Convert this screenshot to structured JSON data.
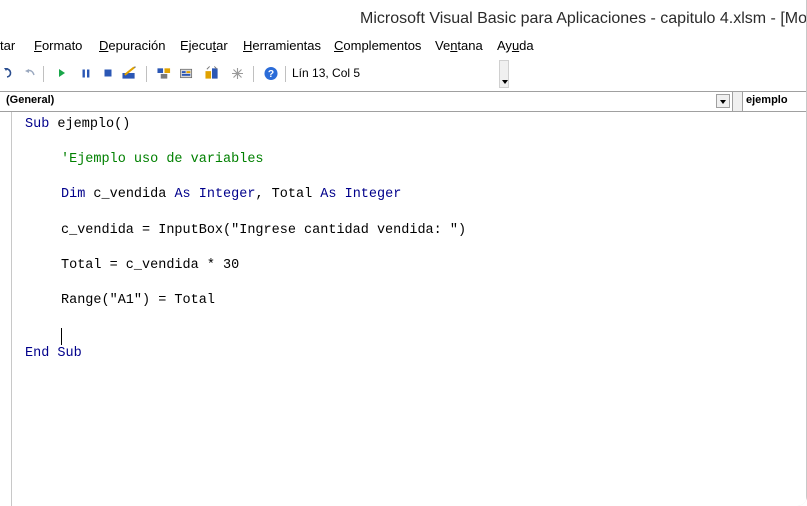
{
  "window": {
    "title": "Microsoft Visual Basic para Aplicaciones - capitulo 4.xlsm - [Mo"
  },
  "menu": {
    "items": [
      {
        "pre": "tar",
        "u": "",
        "post": ""
      },
      {
        "pre": "",
        "u": "F",
        "post": "ormato"
      },
      {
        "pre": "",
        "u": "D",
        "post": "epuración"
      },
      {
        "pre": "Ejecu",
        "u": "t",
        "post": "ar"
      },
      {
        "pre": "",
        "u": "H",
        "post": "erramientas"
      },
      {
        "pre": "",
        "u": "C",
        "post": "omplementos"
      },
      {
        "pre": "Ve",
        "u": "n",
        "post": "tana"
      },
      {
        "pre": "Ay",
        "u": "u",
        "post": "da"
      }
    ]
  },
  "toolbar": {
    "icons": [
      "redo-icon",
      "undo-icon",
      "run-icon",
      "break-icon",
      "reset-icon",
      "design-mode-icon",
      "project-explorer-icon",
      "properties-icon",
      "object-browser-icon",
      "toolbox-icon",
      "help-icon"
    ],
    "position_text": "Lín 13, Col 5"
  },
  "combos": {
    "object": "(General)",
    "procedure": "ejemplo"
  },
  "code": {
    "line1_kw": "Sub",
    "line1_rest": " ejemplo()",
    "line2": "'Ejemplo uso de variables",
    "line3_a": "Dim",
    "line3_b": " c_vendida ",
    "line3_c": "As",
    "line3_d": " ",
    "line3_e": "Integer",
    "line3_f": ", Total ",
    "line3_g": "As",
    "line3_h": " ",
    "line3_i": "Integer",
    "line4": "c_vendida = InputBox(\"Ingrese cantidad vendida: \")",
    "line5": "Total = c_vendida * 30",
    "line6": "Range(\"A1\") = Total",
    "line7_a": "End",
    "line7_b": " ",
    "line7_c": "Sub"
  },
  "colors": {
    "keyword": "#00008b",
    "comment": "#008000"
  }
}
